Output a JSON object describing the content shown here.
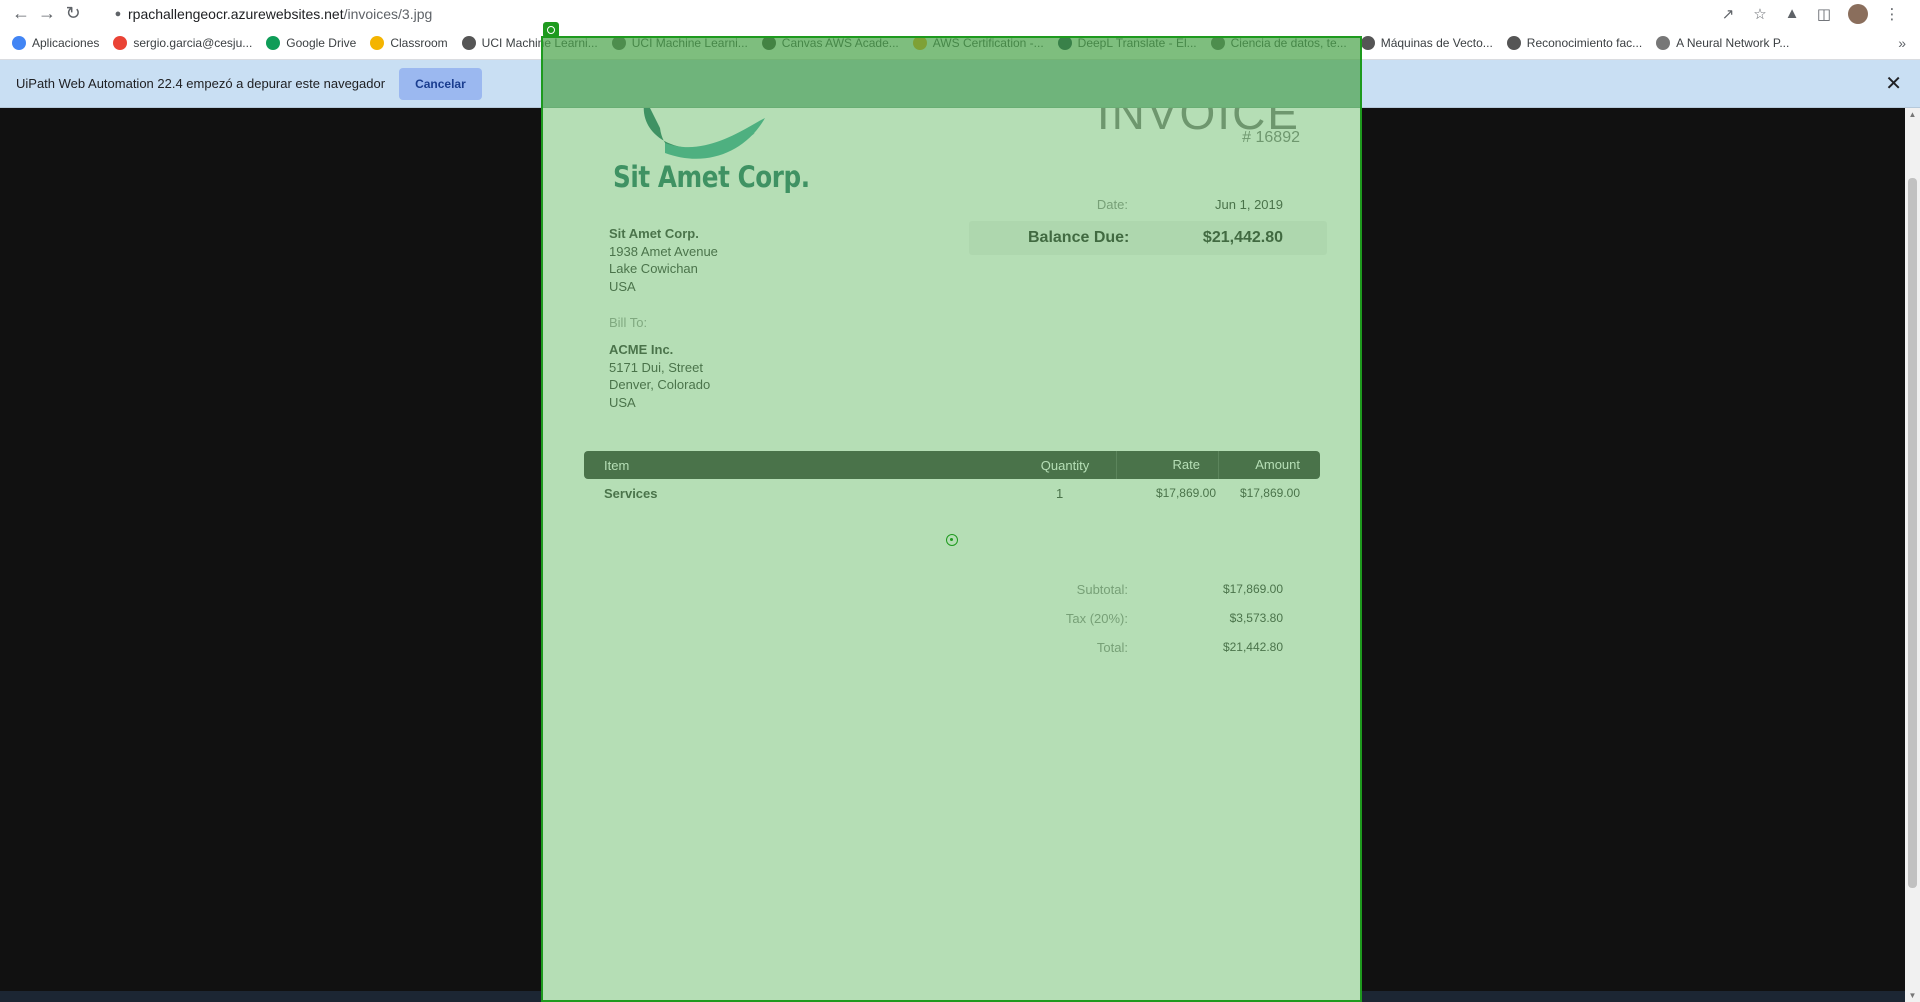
{
  "browser": {
    "url_host": "rpachallengeocr.azurewebsites.net",
    "url_path": "/invoices/3.jpg"
  },
  "bookmarks": [
    {
      "label": "Aplicaciones",
      "icon": "apps-grid-icon",
      "color": "#4285f4"
    },
    {
      "label": "sergio.garcia@cesju...",
      "icon": "gmail-icon",
      "color": "#ea4335"
    },
    {
      "label": "Google Drive",
      "icon": "google-drive-icon",
      "color": "#0f9d58"
    },
    {
      "label": "Classroom",
      "icon": "classroom-icon",
      "color": "#f4b400"
    },
    {
      "label": "UCI Machine Learni...",
      "icon": "uci-icon",
      "color": "#555555"
    },
    {
      "label": "UCI Machine Learni...",
      "icon": "uci-icon",
      "color": "#555555"
    },
    {
      "label": "Canvas AWS Acade...",
      "icon": "canvas-icon",
      "color": "#333333"
    },
    {
      "label": "AWS Certification -...",
      "icon": "aws-icon",
      "color": "#ff9900"
    },
    {
      "label": "DeepL Translate - El...",
      "icon": "deepl-icon",
      "color": "#0f2b46"
    },
    {
      "label": "Ciencia de datos, te...",
      "icon": "globe-icon",
      "color": "#555555"
    },
    {
      "label": "Máquinas de Vecto...",
      "icon": "globe-icon",
      "color": "#555555"
    },
    {
      "label": "Reconocimiento fac...",
      "icon": "globe-icon",
      "color": "#555555"
    },
    {
      "label": "A Neural Network P...",
      "icon": "page-icon",
      "color": "#777777"
    }
  ],
  "infobar": {
    "message": "UiPath Web Automation 22.4 empezó a depurar este navegador",
    "cancel_label": "Cancelar"
  },
  "invoice": {
    "title": "INVOICE",
    "number": "# 16892",
    "company_logo_text": "Sit Amet Corp.",
    "date_label": "Date:",
    "date_value": "Jun 1, 2019",
    "balance_label": "Balance Due:",
    "balance_value": "$21,442.80",
    "from": {
      "name": "Sit Amet Corp.",
      "line1": "1938 Amet Avenue",
      "line2": "Lake Cowichan",
      "line3": "USA"
    },
    "bill_to_label": "Bill To:",
    "bill_to": {
      "name": "ACME Inc.",
      "line1": "5171 Dui, Street",
      "line2": "Denver, Colorado",
      "line3": "USA"
    },
    "table": {
      "headers": {
        "item": "Item",
        "quantity": "Quantity",
        "rate": "Rate",
        "amount": "Amount"
      },
      "rows": [
        {
          "item": "Services",
          "quantity": "1",
          "rate": "$17,869.00",
          "amount": "$17,869.00"
        }
      ]
    },
    "subtotal_label": "Subtotal:",
    "subtotal_value": "$17,869.00",
    "tax_label": "Tax (20%):",
    "tax_value": "$3,573.80",
    "total_label": "Total:",
    "total_value": "$21,442.80"
  },
  "colors": {
    "selection_overlay": "#1e9a1e",
    "table_header": "#333333",
    "logo_teal": "#1d6e62",
    "infobar_bg": "#c9dff3"
  }
}
